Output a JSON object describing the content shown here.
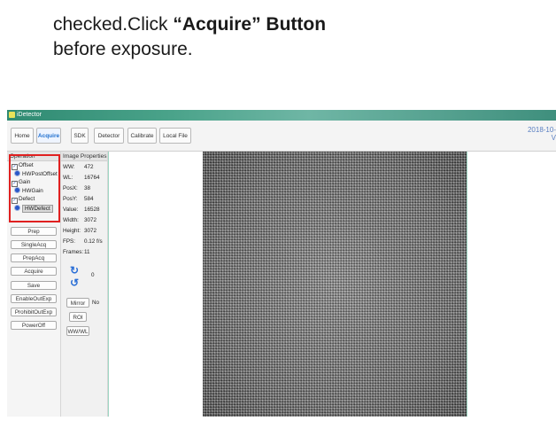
{
  "caption": {
    "line1_plain": "checked.Click ",
    "line1_bold": "“Acquire” Button",
    "line2": "before exposure."
  },
  "window": {
    "title": "iDetector",
    "date": "2018-10-",
    "date_line2": "V"
  },
  "toolbar": {
    "tabs": [
      {
        "label": "Home"
      },
      {
        "label": "Acquire"
      },
      {
        "label": "SDK"
      },
      {
        "label": "Detector"
      },
      {
        "label": "Calibrate"
      },
      {
        "label": "Local File"
      }
    ],
    "active_tab": "Acquire"
  },
  "operation": {
    "header": "Operation",
    "items": [
      {
        "label": "Offset",
        "type": "checkbox",
        "checked": true
      },
      {
        "label": "HWPostOffset",
        "type": "radio",
        "selected": true
      },
      {
        "label": "Gain",
        "type": "checkbox",
        "checked": true
      },
      {
        "label": "HWGain",
        "type": "radio",
        "selected": true
      },
      {
        "label": "Defect",
        "type": "checkbox",
        "checked": true
      },
      {
        "label": "HWDefect",
        "type": "radio",
        "selected": true
      }
    ],
    "highlight_color": "#e02020"
  },
  "side_buttons": [
    "Prep",
    "SingleAcq",
    "PrepAcq",
    "Acquire",
    "Save",
    "EnableOutExp",
    "ProhibitOutExp",
    "PowerOff"
  ],
  "image_properties": {
    "header": "Image Properties",
    "rows": [
      {
        "key": "WW:",
        "value": "472"
      },
      {
        "key": "WL:",
        "value": "16764"
      },
      {
        "key": "PosX:",
        "value": "38"
      },
      {
        "key": "PosY:",
        "value": "584"
      },
      {
        "key": "Value:",
        "value": "16528"
      },
      {
        "key": "Width:",
        "value": "3072"
      },
      {
        "key": "Height:",
        "value": "3072"
      },
      {
        "key": "FPS:",
        "value": "0.12 f/s"
      },
      {
        "key": "Frames:",
        "value": "11"
      }
    ],
    "rotation_value": "0",
    "mirror_label": "Mirror",
    "mirror_value": "No",
    "roi_label": "ROI",
    "wwwl_label": "WW/WL"
  },
  "colors": {
    "accent": "#1f6fcf",
    "titlebar": "#3f8f7d",
    "viewer_border": "#9ed7c4"
  }
}
